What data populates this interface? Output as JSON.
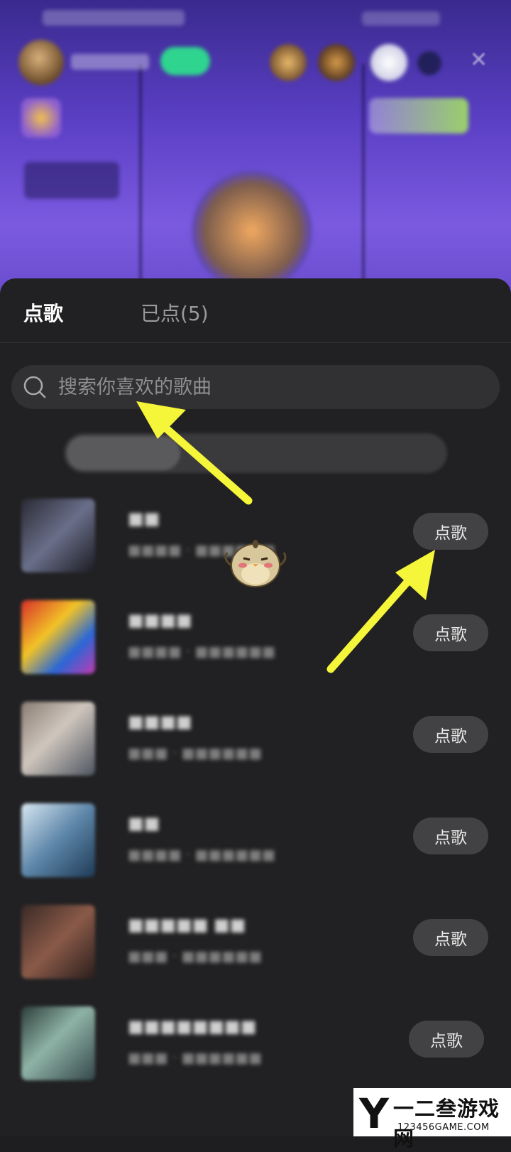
{
  "panel": {
    "tabs": [
      {
        "label": "点歌",
        "active": true
      },
      {
        "label": "已点(5)",
        "active": false
      }
    ],
    "search": {
      "placeholder": "搜索你喜欢的歌曲",
      "value": ""
    },
    "songs": [
      {
        "button_label": "点歌"
      },
      {
        "button_label": "点歌"
      },
      {
        "button_label": "点歌"
      },
      {
        "button_label": "点歌"
      },
      {
        "button_label": "点歌"
      },
      {
        "button_label": "点歌"
      }
    ]
  },
  "watermark": {
    "letter": "Y",
    "name": "一二叁游戏网",
    "url": "123456GAME.COM"
  },
  "colors": {
    "panel_bg": "#212123",
    "accent_follow": "#2fd48f",
    "arrow": "#f5f53a",
    "room_gradient_top": "#3a2a8e",
    "room_gradient_bottom": "#7b5ae0"
  },
  "icons": [
    "search-icon",
    "close-icon",
    "mascot-icon",
    "arrow-annotation"
  ]
}
